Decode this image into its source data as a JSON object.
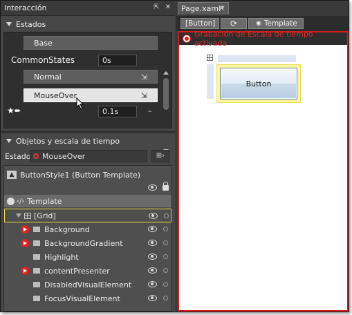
{
  "left_panel": {
    "title": "Interacción",
    "states": {
      "section_title": "Estados",
      "base_label": "Base",
      "group_name": "CommonStates",
      "group_duration": "0s",
      "state_normal": "Normal",
      "state_mouseover": "MouseOver",
      "transition_duration": "0.1s",
      "transition_minus": "–"
    },
    "objects": {
      "section_title": "Objetos y escala de tiempo",
      "estado_label": "Estado",
      "estado_value": "MouseOver",
      "template_root": "ButtonStyle1 (Button Template)",
      "template_label": "Template",
      "tree": [
        {
          "label": "[Grid]",
          "recording": false,
          "kind": "grid"
        },
        {
          "label": "Background",
          "recording": true,
          "kind": "rect"
        },
        {
          "label": "BackgroundGradient",
          "recording": true,
          "kind": "rect"
        },
        {
          "label": "Highlight",
          "recording": false,
          "kind": "rect"
        },
        {
          "label": "contentPresenter",
          "recording": true,
          "kind": "rect"
        },
        {
          "label": "DisabledVisualElement",
          "recording": false,
          "kind": "rect"
        },
        {
          "label": "FocusVisualElement",
          "recording": false,
          "kind": "rect"
        }
      ]
    }
  },
  "right_panel": {
    "tab_label": "Page.xaml*",
    "tab_close": "×",
    "crumbs": [
      "[Button]",
      "Template"
    ],
    "recording_banner": "Grabación de Escala de tiempo activada",
    "button_text": "Button"
  },
  "colors": {
    "recording_red": "#d21c1c",
    "selection_yellow": "#fbf7a0"
  }
}
